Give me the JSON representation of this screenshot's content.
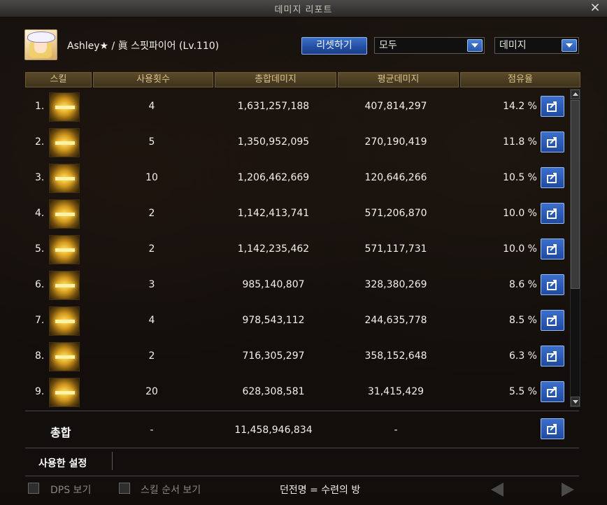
{
  "window": {
    "title": "데미지 리포트",
    "close_symbol": "×"
  },
  "header": {
    "player_text": "Ashley★ / 眞 스핏파이어 (Lv.110)",
    "reset_label": "리셋하기",
    "filter_select": "모두",
    "metric_select": "데미지"
  },
  "table": {
    "columns": [
      "스킬",
      "사용횟수",
      "총합데미지",
      "평균데미지",
      "점유율"
    ],
    "rows": [
      {
        "rank": "1.",
        "uses": "4",
        "total": "1,631,257,188",
        "avg": "407,814,297",
        "share": "14.2 %"
      },
      {
        "rank": "2.",
        "uses": "5",
        "total": "1,350,952,095",
        "avg": "270,190,419",
        "share": "11.8 %"
      },
      {
        "rank": "3.",
        "uses": "10",
        "total": "1,206,462,669",
        "avg": "120,646,266",
        "share": "10.5 %"
      },
      {
        "rank": "4.",
        "uses": "2",
        "total": "1,142,413,741",
        "avg": "571,206,870",
        "share": "10.0 %"
      },
      {
        "rank": "5.",
        "uses": "2",
        "total": "1,142,235,462",
        "avg": "571,117,731",
        "share": "10.0 %"
      },
      {
        "rank": "6.",
        "uses": "3",
        "total": "985,140,807",
        "avg": "328,380,269",
        "share": "8.6 %"
      },
      {
        "rank": "7.",
        "uses": "4",
        "total": "978,543,112",
        "avg": "244,635,778",
        "share": "8.5 %"
      },
      {
        "rank": "8.",
        "uses": "2",
        "total": "716,305,297",
        "avg": "358,152,648",
        "share": "6.3 %"
      },
      {
        "rank": "9.",
        "uses": "20",
        "total": "628,308,581",
        "avg": "31,415,429",
        "share": "5.5 %"
      }
    ]
  },
  "summary": {
    "label": "총합",
    "uses": "-",
    "total": "11,458,946,834",
    "avg": "-"
  },
  "settings": {
    "used_settings_label": "사용한 설정"
  },
  "footer": {
    "dps_label": "DPS 보기",
    "skill_order_label": "스킬 순서 보기",
    "dungeon_text": "던전명 = 수련의 방"
  },
  "icons": {
    "skill": "skill-icon",
    "share": "share-icon"
  },
  "colors": {
    "accent_blue": "#2450a6",
    "header_gold": "#d8c28a"
  }
}
